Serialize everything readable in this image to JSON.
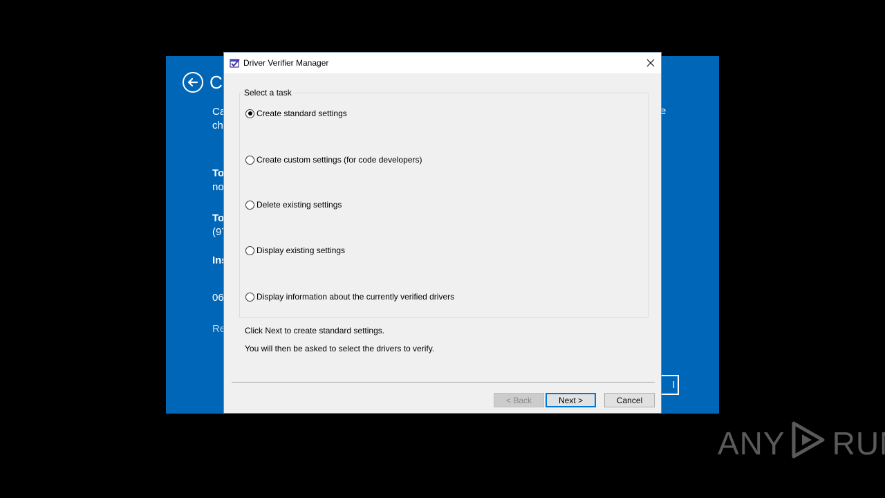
{
  "background": {
    "title_fragment": "C",
    "lines": [
      {
        "text": "Ca",
        "bold": false
      },
      {
        "text": "ch",
        "bold": false
      },
      {
        "text": "To",
        "bold": true
      },
      {
        "text": "no",
        "bold": false
      },
      {
        "text": "To",
        "bold": true
      },
      {
        "text": "(97",
        "bold": false
      },
      {
        "text": "Ins",
        "bold": true
      },
      {
        "text": "06",
        "bold": false
      },
      {
        "text": "Re",
        "bold": false
      }
    ],
    "right_fragment": "e",
    "button_fragment": "l"
  },
  "dialog": {
    "title": "Driver Verifier Manager",
    "group_label": "Select a task",
    "options": [
      {
        "label": "Create standard settings",
        "checked": true
      },
      {
        "label": "Create custom settings (for code developers)",
        "checked": false
      },
      {
        "label": "Delete existing settings",
        "checked": false
      },
      {
        "label": "Display existing settings",
        "checked": false
      },
      {
        "label": "Display information about the currently verified drivers",
        "checked": false
      }
    ],
    "info_line_1": "Click Next to create standard settings.",
    "info_line_2": "You will then be asked to select the drivers to verify.",
    "buttons": {
      "back": "< Back",
      "next": "Next >",
      "cancel": "Cancel"
    }
  },
  "watermark": {
    "left": "ANY",
    "right": "RUN"
  },
  "colors": {
    "background_app": "#0067b8",
    "dialog_bg": "#f0f0f0",
    "accent": "#0078d7"
  }
}
